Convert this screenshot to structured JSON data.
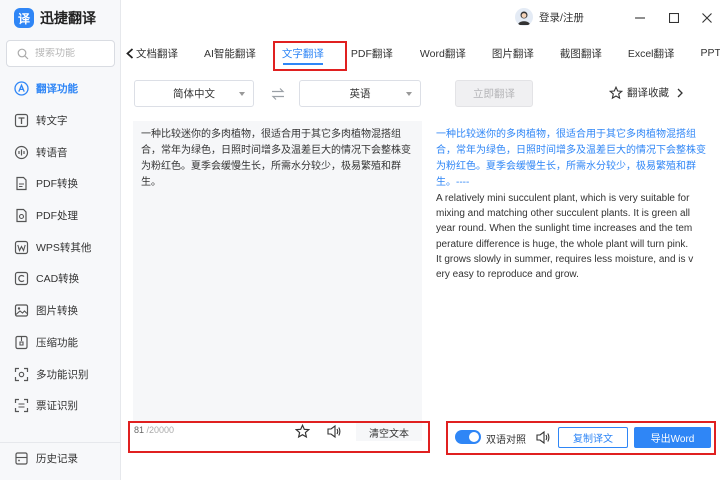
{
  "app": {
    "name": "迅捷翻译",
    "logo_glyph": "译"
  },
  "search": {
    "placeholder": "搜索功能"
  },
  "sidebar": {
    "items": [
      {
        "label": "翻译功能",
        "icon": "translate-a-icon",
        "active": true
      },
      {
        "label": "转文字",
        "icon": "text-t-icon"
      },
      {
        "label": "转语音",
        "icon": "voice-icon"
      },
      {
        "label": "PDF转换",
        "icon": "pdf-convert-icon"
      },
      {
        "label": "PDF处理",
        "icon": "pdf-process-icon"
      },
      {
        "label": "WPS转其他",
        "icon": "wps-icon"
      },
      {
        "label": "CAD转换",
        "icon": "cad-icon"
      },
      {
        "label": "图片转换",
        "icon": "image-icon"
      },
      {
        "label": "压缩功能",
        "icon": "compress-icon"
      },
      {
        "label": "多功能识别",
        "icon": "scan-icon"
      },
      {
        "label": "票证识别",
        "icon": "ticket-icon"
      }
    ],
    "bottom": {
      "label": "历史记录",
      "icon": "history-icon"
    }
  },
  "user": {
    "login_label": "登录/注册"
  },
  "tabs": [
    {
      "label": "文档翻译"
    },
    {
      "label": "AI智能翻译"
    },
    {
      "label": "文字翻译",
      "active": true
    },
    {
      "label": "PDF翻译"
    },
    {
      "label": "Word翻译"
    },
    {
      "label": "图片翻译"
    },
    {
      "label": "截图翻译"
    },
    {
      "label": "Excel翻译"
    },
    {
      "label": "PPT"
    }
  ],
  "translate": {
    "source_lang": "简体中文",
    "target_lang": "英语",
    "translate_button": "立即翻译",
    "favorites_label": "翻译收藏"
  },
  "source": {
    "text": "一种比较迷你的多肉植物，很适合用于其它多肉植物混搭组合，常年为绿色，日照时间增多及温差巨大的情况下会整株变为粉红色。夏季会缓慢生长，所需水分较少，极易繁殖和群生。",
    "char_count": "81",
    "char_limit": "/20000",
    "clear_label": "清空文本"
  },
  "target": {
    "chinese_text": "一种比较迷你的多肉植物，很适合用于其它多肉植物混搭组合，常年为绿色，日照时间增多及温差巨大的情况下会整株变为粉红色。夏季会缓慢生长，所需水分较少，极易繁殖和群生。----",
    "english_lines": [
      "A relatively mini succulent plant, which is very suitable for",
      "mixing and matching other succulent plants. It is green all",
      "year round. When the sunlight time increases and the tem",
      "perature difference is huge, the whole plant will turn pink.",
      "It grows slowly in summer, requires less moisture, and is v",
      "ery easy to reproduce and grow."
    ],
    "bilingual_label": "双语对照",
    "bilingual_on": true,
    "copy_label": "复制译文",
    "export_label": "导出Word"
  },
  "colors": {
    "accent": "#2f86f6",
    "highlight": "#e02020"
  }
}
